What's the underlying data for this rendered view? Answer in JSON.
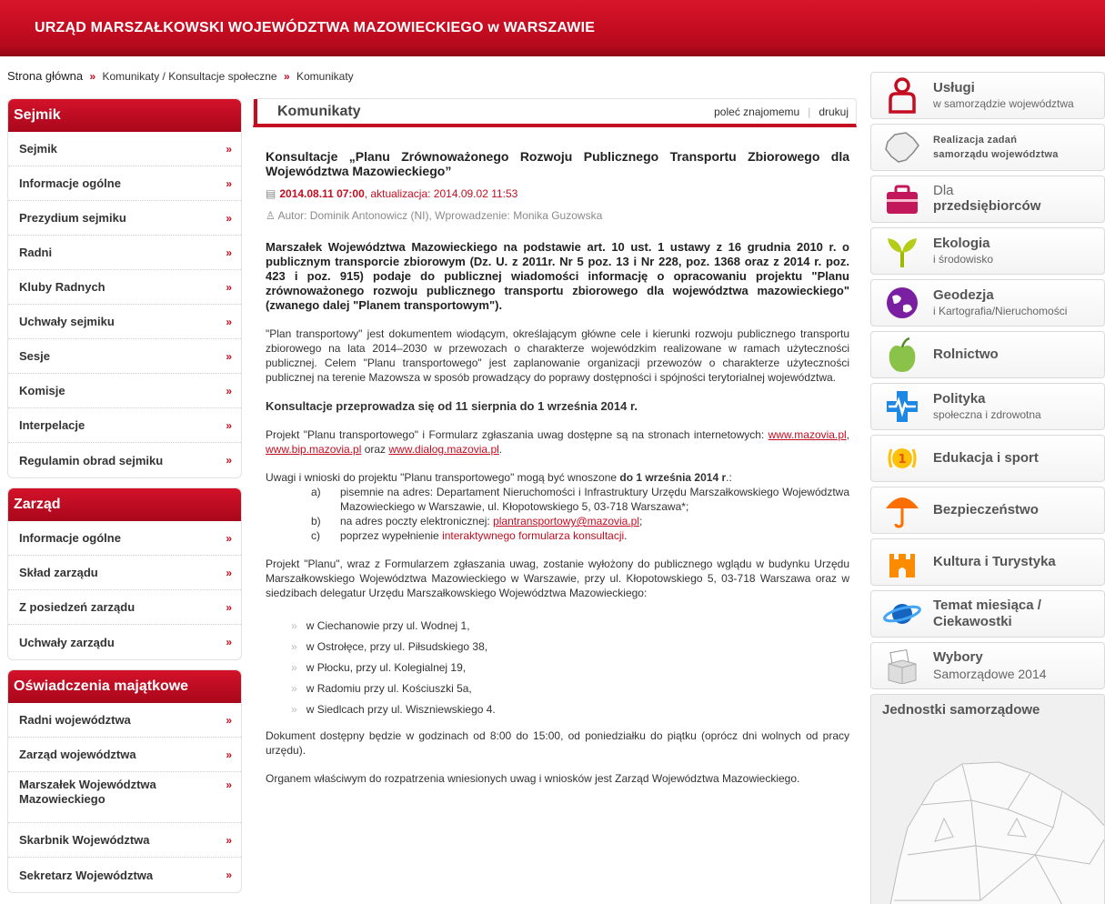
{
  "header": {
    "title": "URZĄD MARSZAŁKOWSKI WOJEWÓDZTWA MAZOWIECKIEGO w WARSZAWIE"
  },
  "breadcrumb": {
    "home": "Strona główna",
    "sep": "»",
    "crumb1": "Komunikaty / Konsultacje społeczne",
    "crumb2": "Komunikaty"
  },
  "sidebar": {
    "arrow": "»",
    "sejmik": {
      "title": "Sejmik",
      "items": [
        "Sejmik",
        "Informacje ogólne",
        "Prezydium sejmiku",
        "Radni",
        "Kluby Radnych",
        "Uchwały sejmiku",
        "Sesje",
        "Komisje",
        "Interpelacje",
        "Regulamin obrad sejmiku"
      ]
    },
    "zarzad": {
      "title": "Zarząd",
      "items": [
        "Informacje ogólne",
        "Skład zarządu",
        "Z posiedzeń zarządu",
        "Uchwały zarządu"
      ]
    },
    "oswiadczenia": {
      "title": "Oświadczenia majątkowe",
      "items": [
        "Radni województwa",
        "Zarząd województwa",
        "Marszałek Województwa Mazowieckiego",
        "Skarbnik Województwa",
        "Sekretarz Województwa"
      ]
    }
  },
  "main": {
    "tab_title": "Komunikaty",
    "recommend": "poleć znajomemu",
    "print": "drukuj",
    "article": {
      "title": "Konsultacje „Planu Zrównoważonego Rozwoju Publicznego Transportu Zbiorowego dla Województwa Mazowieckiego”",
      "date": "2014.08.11 07:00",
      "update": ", aktualizacja: 2014.09.02 11:53",
      "author": "Autor: Dominik Antonowicz (NI), Wprowadzenie: Monika Guzowska",
      "lead": "Marszałek Województwa Mazowieckiego na podstawie art. 10 ust. 1 ustawy z 16 grudnia 2010 r. o publicznym transporcie zbiorowym (Dz. U. z 2011r. Nr 5 poz. 13 i Nr 228, poz. 1368 oraz z 2014 r. poz. 423 i poz. 915) podaje do publicznej wiadomości informację o opracowaniu projektu \"Planu zrównoważonego rozwoju publicznego transportu zbiorowego dla województwa mazowieckiego\" (zwanego dalej \"Planem transportowym\").",
      "p1": "\"Plan transportowy\" jest dokumentem wiodącym, określającym główne cele i kierunki rozwoju publicznego transportu zbiorowego na lata 2014–2030 w przewozach o charakterze wojewódzkim realizowane w ramach użyteczności publicznej. Celem \"Planu transportowego\" jest zaplanowanie organizacji przewozów o charakterze użyteczności publicznej na terenie Mazowsza w sposób prowadzący do poprawy dostępności i spójności terytorialnej województwa.",
      "consult": "Konsultacje przeprowadza się od 11 sierpnia do 1 września 2014 r.",
      "p2_text": "Projekt \"Planu transportowego\" i Formularz zgłaszania uwag dostępne są na stronach internetowych: ",
      "link1": "www.mazovia.pl",
      "link2": "www.bip.mazovia.pl",
      "and": " oraz ",
      "link3": "www.dialog.mazovia.pl",
      "p3_text": "Uwagi i wnioski do projektu \"Planu transportowego\" mogą być wnoszone ",
      "p3_bold": "do 1 września 2014 r",
      "p3_end": ".:",
      "opt_a_letter": "a)",
      "opt_a": "pisemnie na adres: Departament Nieruchomości i Infrastruktury Urzędu Marszałkowskiego Województwa Mazowieckiego w Warszawie, ul. Kłopotowskiego 5, 03-718 Warszawa*;",
      "opt_b_letter": "b)",
      "opt_b": "na adres poczty elektronicznej: ",
      "opt_b_link": "plantransportowy@mazovia.pl",
      "opt_c_letter": "c)",
      "opt_c": "poprzez wypełnienie ",
      "opt_c_link": "interaktywnego formularza konsultacji",
      "p4": "Projekt \"Planu\", wraz z Formularzem zgłaszania uwag, zostanie wyłożony do publicznego wglądu w budynku Urzędu Marszałkowskiego Województwa Mazowieckiego w Warszawie, przy ul. Kłopotowskiego 5, 03-718 Warszawa oraz w siedzibach delegatur Urzędu Marszałkowskiego Województwa Mazowieckiego:",
      "locations": [
        "w Ciechanowie przy ul. Wodnej 1,",
        "w Ostrołęce, przy ul. Piłsudskiego 38,",
        "w Płocku, przy ul. Kolegialnej 19,",
        "w Radomiu przy ul. Kościuszki 5a,",
        "w Siedlcach przy ul. Wiszniewskiego 4."
      ],
      "p5": "Dokument dostępny będzie w godzinach od 8:00 do 15:00, od poniedziałku do piątku (oprócz dni wolnych od pracy urzędu).",
      "p6": "Organem właściwym do rozpatrzenia wniesionych uwag i wniosków jest Zarząd Województwa Mazowieckiego."
    }
  },
  "right": {
    "tiles": [
      {
        "l1": "Usługi",
        "l2": "w samorządzie województwa",
        "icon": "person-icon"
      },
      {
        "l1": "Realizacja zadań",
        "l2": "samorządu województwa",
        "icon": "map-icon"
      },
      {
        "l1": "Dla",
        "l2": "przedsiębiorców",
        "icon": "briefcase-icon"
      },
      {
        "l1": "Ekologia",
        "l2": "i środowisko",
        "icon": "sprout-icon"
      },
      {
        "l1": "Geodezja",
        "l2": "i Kartografia/Nieruchomości",
        "icon": "globe-icon"
      },
      {
        "l1": "Rolnictwo",
        "icon": "apple-icon"
      },
      {
        "l1": "Polityka",
        "l2": "społeczna i zdrowotna",
        "icon": "health-cross-icon"
      },
      {
        "l1": "Edukacja i sport",
        "icon": "medal-icon"
      },
      {
        "l1": "Bezpieczeństwo",
        "icon": "umbrella-icon"
      },
      {
        "l1": "Kultura i Turystyka",
        "icon": "castle-icon"
      },
      {
        "l1": "Temat miesiąca /",
        "l2": "Ciekawostki",
        "icon": "planet-icon"
      },
      {
        "l1": "Wybory",
        "l2": "Samorządowe 2014",
        "icon": "ballot-box-icon"
      }
    ],
    "units_title": "Jednostki samorządowe"
  },
  "colors": {
    "brand_red": "#c40d20"
  }
}
